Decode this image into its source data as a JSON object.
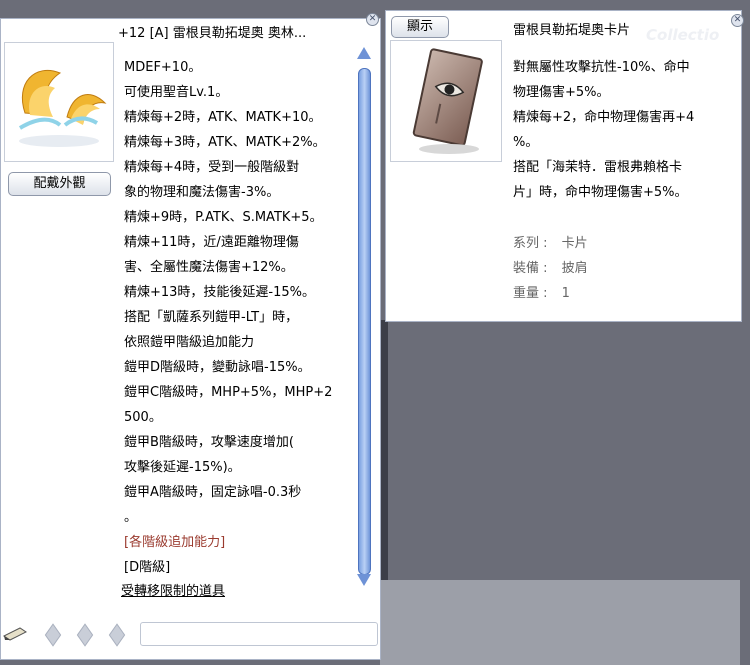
{
  "item_window": {
    "title": "+12 [A] 雷根貝勒拓堤奧 奧林...",
    "appearance_button": "配戴外觀",
    "description_lines": [
      "MDEF+10。",
      "可使用聖音Lv.1。",
      "精煉每+2時，ATK、MATK+10。",
      "精煉每+3時，ATK、MATK+2%。",
      "精煉每+4時，受到一般階級對",
      "象的物理和魔法傷害-3%。",
      "精煉+9時，P.ATK、S.MATK+5。",
      "精煉+11時，近/遠距離物理傷",
      "害、全屬性魔法傷害+12%。",
      "精煉+13時，技能後延遲-15%。",
      "搭配「凱薩系列鎧甲-LT」時，",
      "依照鎧甲階級追加能力",
      "鎧甲D階級時，變動詠唱-15%。",
      "鎧甲C階級時，MHP+5%，MHP+2",
      "500。",
      "鎧甲B階級時，攻擊速度增加(",
      "攻擊後延遲-15%)。",
      "鎧甲A階級時，固定詠唱-0.3秒",
      "。"
    ],
    "grade_header": "[各階級追加能力]",
    "grade_label": "[D階級]",
    "restriction_link": "受轉移限制的道具"
  },
  "card_window": {
    "display_button": "顯示",
    "title": "雷根貝勒拓堤奧卡片",
    "description_lines": [
      "對無屬性攻擊抗性-10%、命中",
      "物理傷害+5%。",
      "精煉每+2，命中物理傷害再+4",
      "%。",
      "搭配「海茉特．雷根弗賴格卡",
      "片」時，命中物理傷害+5%。"
    ],
    "properties": [
      {
        "label": "系列 :",
        "value": "卡片"
      },
      {
        "label": "裝備 :",
        "value": "披肩"
      },
      {
        "label": "重量 :",
        "value": "1"
      }
    ],
    "watermark": "Collectio"
  },
  "colors": {
    "border": "#aab3c6",
    "scroll": "#7aa0e0",
    "red_text": "#9a3a2e"
  }
}
